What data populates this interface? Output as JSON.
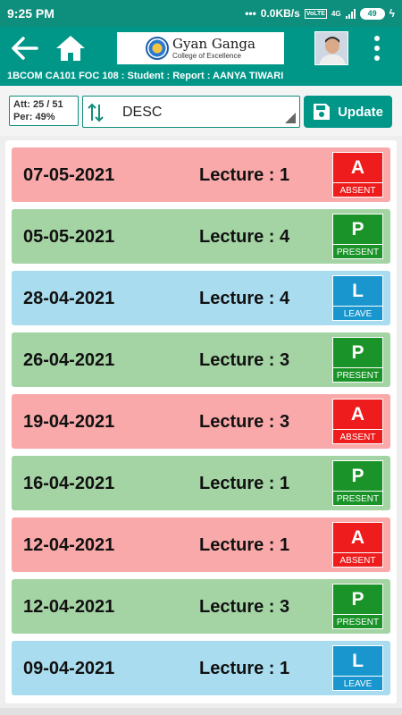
{
  "status_bar": {
    "time": "9:25 PM",
    "net_speed": "0.0KB/s",
    "volte": "VoLTE",
    "network": "4G",
    "battery": "49"
  },
  "app_bar": {
    "logo_name": "Gyan Ganga",
    "logo_sub": "College of Excellence",
    "subtitle": "1BCOM CA101 FOC 108 : Student : Report : AANYA TIWARI"
  },
  "controls": {
    "att_line": "Att: 25 / 51",
    "per_line": "Per: 49%",
    "sort_value": "DESC",
    "update_label": "Update"
  },
  "records": [
    {
      "date": "07-05-2021",
      "lecture": "Lecture : 1",
      "code": "A",
      "word": "ABSENT",
      "status": "absent"
    },
    {
      "date": "05-05-2021",
      "lecture": "Lecture : 4",
      "code": "P",
      "word": "PRESENT",
      "status": "present"
    },
    {
      "date": "28-04-2021",
      "lecture": "Lecture : 4",
      "code": "L",
      "word": "LEAVE",
      "status": "leave"
    },
    {
      "date": "26-04-2021",
      "lecture": "Lecture : 3",
      "code": "P",
      "word": "PRESENT",
      "status": "present"
    },
    {
      "date": "19-04-2021",
      "lecture": "Lecture : 3",
      "code": "A",
      "word": "ABSENT",
      "status": "absent"
    },
    {
      "date": "16-04-2021",
      "lecture": "Lecture : 1",
      "code": "P",
      "word": "PRESENT",
      "status": "present"
    },
    {
      "date": "12-04-2021",
      "lecture": "Lecture : 1",
      "code": "A",
      "word": "ABSENT",
      "status": "absent"
    },
    {
      "date": "12-04-2021",
      "lecture": "Lecture : 3",
      "code": "P",
      "word": "PRESENT",
      "status": "present"
    },
    {
      "date": "09-04-2021",
      "lecture": "Lecture : 1",
      "code": "L",
      "word": "LEAVE",
      "status": "leave"
    }
  ],
  "colors": {
    "primary": "#009688",
    "absent_row": "#f9a9a9",
    "present_row": "#a4d3a4",
    "leave_row": "#a9dcee",
    "absent_badge": "#ee1c1c",
    "present_badge": "#1a9428",
    "leave_badge": "#1a96cf"
  },
  "icons": {
    "back": "arrow-left-icon",
    "home": "home-icon",
    "menu": "more-vert-icon",
    "sort": "swap-vertical-icon",
    "save": "floppy-disk-icon"
  }
}
